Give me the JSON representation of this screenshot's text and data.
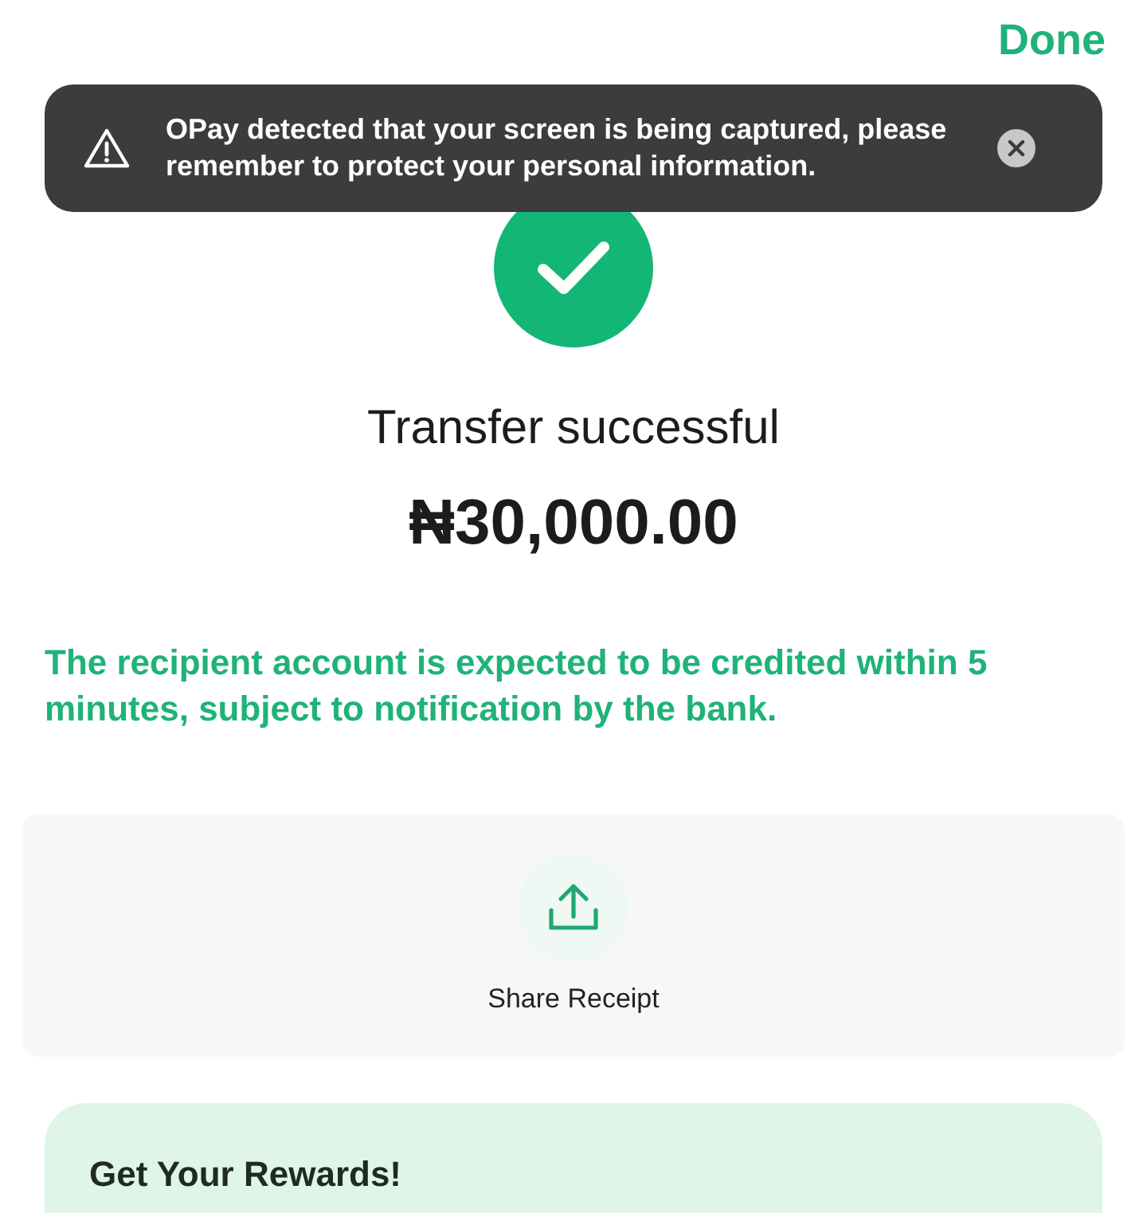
{
  "header": {
    "done_label": "Done"
  },
  "toast": {
    "message": "OPay detected that your screen is being captured, please remember to protect your personal information."
  },
  "status": {
    "kind": "success",
    "title": "Transfer successful",
    "amount": "₦30,000.00"
  },
  "notice": "The recipient account is expected to be credited within 5 minutes, subject to notification by the bank.",
  "share": {
    "label": "Share Receipt"
  },
  "rewards": {
    "title": "Get Your Rewards!"
  }
}
